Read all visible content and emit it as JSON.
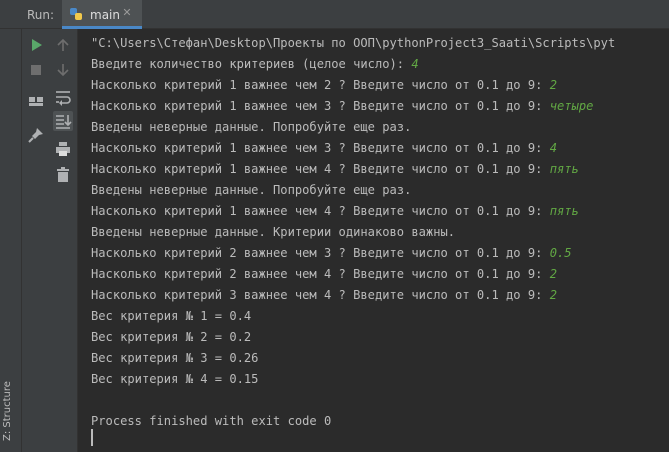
{
  "toolbar": {
    "run_label": "Run:",
    "tab_label": "main",
    "structure_label": "Z: Structure"
  },
  "console": {
    "lines": [
      {
        "text": "\"C:\\Users\\Стефан\\Desktop\\Проекты по ООП\\pythonProject3_Saati\\Scripts\\pyt",
        "input": ""
      },
      {
        "text": "Введите количество критериев (целое число): ",
        "input": "4"
      },
      {
        "text": "Насколько критерий 1 важнее чем 2 ? Введите число от 0.1 до 9: ",
        "input": "2"
      },
      {
        "text": "Насколько критерий 1 важнее чем 3 ? Введите число от 0.1 до 9: ",
        "input": "четыре"
      },
      {
        "text": "Введены неверные данные. Попробуйте еще раз.",
        "input": ""
      },
      {
        "text": "Насколько критерий 1 важнее чем 3 ? Введите число от 0.1 до 9: ",
        "input": "4"
      },
      {
        "text": "Насколько критерий 1 важнее чем 4 ? Введите число от 0.1 до 9: ",
        "input": "пять"
      },
      {
        "text": "Введены неверные данные. Попробуйте еще раз.",
        "input": ""
      },
      {
        "text": "Насколько критерий 1 важнее чем 4 ? Введите число от 0.1 до 9: ",
        "input": "пять"
      },
      {
        "text": "Введены неверные данные. Критерии одинаково важны.",
        "input": ""
      },
      {
        "text": "Насколько критерий 2 важнее чем 3 ? Введите число от 0.1 до 9: ",
        "input": "0.5"
      },
      {
        "text": "Насколько критерий 2 важнее чем 4 ? Введите число от 0.1 до 9: ",
        "input": "2"
      },
      {
        "text": "Насколько критерий 3 важнее чем 4 ? Введите число от 0.1 до 9: ",
        "input": "2"
      },
      {
        "text": "Вес критерия № 1 = 0.4",
        "input": ""
      },
      {
        "text": "Вес критерия № 2 = 0.2",
        "input": ""
      },
      {
        "text": "Вес критерия № 3 = 0.26",
        "input": ""
      },
      {
        "text": "Вес критерия № 4 = 0.15",
        "input": ""
      },
      {
        "text": "",
        "input": ""
      },
      {
        "text": "Process finished with exit code 0",
        "input": ""
      }
    ]
  },
  "colors": {
    "background": "#2b2b2b",
    "text": "#bbbbbb",
    "user_input": "#62a844",
    "run_icon": "#59a869",
    "tab_underline": "#4a88c7"
  },
  "icons": {
    "run": "play-icon",
    "stop": "stop-icon",
    "up": "arrow-up-icon",
    "down": "arrow-down-icon",
    "layout": "layout-icon",
    "wrap": "soft-wrap-icon",
    "pin": "pin-icon",
    "scroll": "scroll-to-end-icon",
    "print": "print-icon",
    "trash": "trash-icon",
    "python": "python-icon"
  }
}
